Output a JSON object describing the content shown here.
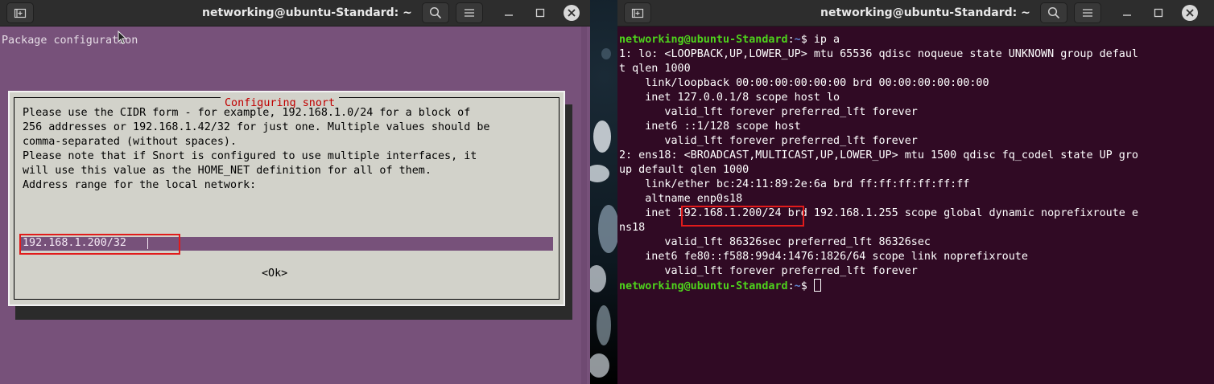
{
  "left_window": {
    "title": "networking@ubuntu-Standard: ~",
    "terminal": {
      "header": "Package configuration",
      "dialog": {
        "title": "Configuring snort",
        "lines": [
          "Please use the CIDR form - for example, 192.168.1.0/24 for a block of",
          "256 addresses or 192.168.1.42/32 for just one. Multiple values should be",
          "comma-separated (without spaces).",
          "",
          "Please note that if Snort is configured to use multiple interfaces, it",
          "will use this value as the HOME_NET definition for all of them.",
          "",
          "Address range for the local network:"
        ],
        "input_value": "192.168.1.200/32",
        "ok_label": "<Ok>"
      }
    }
  },
  "right_window": {
    "title": "networking@ubuntu-Standard: ~",
    "terminal": {
      "prompt_user_host": "networking@ubuntu-Standard",
      "prompt_colon": ":",
      "prompt_path": "~",
      "prompt_symbol": "$ ",
      "command": "ip a",
      "output_lines": [
        "1: lo: <LOOPBACK,UP,LOWER_UP> mtu 65536 qdisc noqueue state UNKNOWN group defaul",
        "t qlen 1000",
        "    link/loopback 00:00:00:00:00:00 brd 00:00:00:00:00:00",
        "    inet 127.0.0.1/8 scope host lo",
        "       valid_lft forever preferred_lft forever",
        "    inet6 ::1/128 scope host",
        "       valid_lft forever preferred_lft forever",
        "2: ens18: <BROADCAST,MULTICAST,UP,LOWER_UP> mtu 1500 qdisc fq_codel state UP gro",
        "up default qlen 1000",
        "    link/ether bc:24:11:89:2e:6a brd ff:ff:ff:ff:ff:ff",
        "    altname enp0s18",
        "    inet 192.168.1.200/24 brd 192.168.1.255 scope global dynamic noprefixroute e",
        "ns18",
        "       valid_lft 86326sec preferred_lft 86326sec",
        "    inet6 fe80::f588:99d4:1476:1826/64 scope link noprefixroute",
        "       valid_lft forever preferred_lft forever"
      ]
    }
  },
  "colors": {
    "left_terminal_bg": "#77517a",
    "right_terminal_bg": "#300a24",
    "prompt_green": "#4ed31c",
    "path_blue": "#5f86d4",
    "dialog_title_red": "#c00000",
    "highlight_box_red": "#e11b1b"
  }
}
